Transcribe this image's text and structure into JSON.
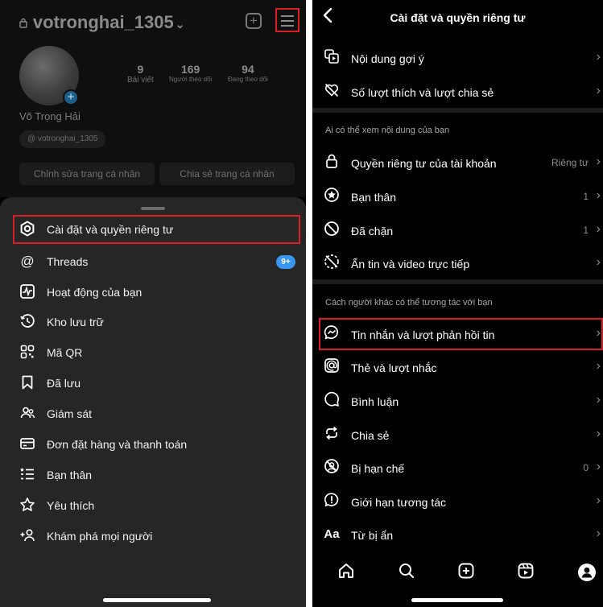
{
  "left": {
    "profile": {
      "lock_icon": "lock-icon",
      "username": "votronghai_1305",
      "username_chevron": "⌄",
      "stats": [
        {
          "value": "9",
          "label": "Bài viết"
        },
        {
          "value": "169",
          "label": "Người theo dõi"
        },
        {
          "value": "94",
          "label": "Đang theo dõi"
        }
      ],
      "full_name": "Võ Trọng Hải",
      "threads_handle": "votronghai_1305",
      "buttons": {
        "edit": "Chỉnh sửa trang cá nhân",
        "share": "Chia sẻ trang cá nhân"
      }
    },
    "menu": {
      "items": [
        {
          "label": "Cài đặt và quyền riêng tư",
          "icon": "settings-icon"
        },
        {
          "label": "Threads",
          "icon": "threads-icon",
          "badge": "9+"
        },
        {
          "label": "Hoạt động của bạn",
          "icon": "activity-icon"
        },
        {
          "label": "Kho lưu trữ",
          "icon": "archive-icon"
        },
        {
          "label": "Mã QR",
          "icon": "qr-code-icon"
        },
        {
          "label": "Đã lưu",
          "icon": "bookmark-icon"
        },
        {
          "label": "Giám sát",
          "icon": "supervision-icon"
        },
        {
          "label": "Đơn đặt hàng và thanh toán",
          "icon": "card-icon"
        },
        {
          "label": "Bạn thân",
          "icon": "close-friends-list-icon"
        },
        {
          "label": "Yêu thích",
          "icon": "star-icon"
        },
        {
          "label": "Khám phá mọi người",
          "icon": "add-person-icon"
        }
      ]
    }
  },
  "right": {
    "header": {
      "title": "Cài đặt và quyền riêng tư"
    },
    "group1": [
      {
        "label": "Nội dung gợi ý",
        "icon": "suggested-content-icon"
      },
      {
        "label": "Số lượt thích và lượt chia sẻ",
        "icon": "hidden-likes-icon"
      }
    ],
    "section1": "Ai có thể xem nội dung của bạn",
    "group2": [
      {
        "label": "Quyền riêng tư của tài khoản",
        "value": "Riêng tư",
        "icon": "lock-icon"
      },
      {
        "label": "Bạn thân",
        "value": "1",
        "icon": "star-circle-icon"
      },
      {
        "label": "Đã chặn",
        "value": "1",
        "icon": "block-icon"
      },
      {
        "label": "Ẩn tin và video trực tiếp",
        "icon": "hide-story-icon"
      }
    ],
    "section2": "Cách người khác có thể tương tác với bạn",
    "group3": [
      {
        "label": "Tin nhắn và lượt phản hồi tin",
        "icon": "messenger-icon"
      },
      {
        "label": "Thẻ và lượt nhắc",
        "icon": "mention-icon"
      },
      {
        "label": "Bình luận",
        "icon": "comment-icon"
      },
      {
        "label": "Chia sẻ",
        "icon": "share-icon"
      },
      {
        "label": "Bị hạn chế",
        "value": "0",
        "icon": "restricted-icon"
      },
      {
        "label": "Giới hạn tương tác",
        "icon": "limit-icon"
      },
      {
        "label": "Từ bị ẩn",
        "icon": "hidden-words-icon"
      }
    ],
    "bottom_nav": [
      "home-icon",
      "search-icon",
      "create-icon",
      "reels-icon",
      "profile-icon"
    ],
    "icon_glyph_hidden_words": "Aa"
  },
  "colors": {
    "background": "#000000",
    "sheet": "#262626",
    "highlight_border": "#d81f26",
    "badge": "#3a96f0",
    "secondary_text": "#8e8e8e"
  }
}
